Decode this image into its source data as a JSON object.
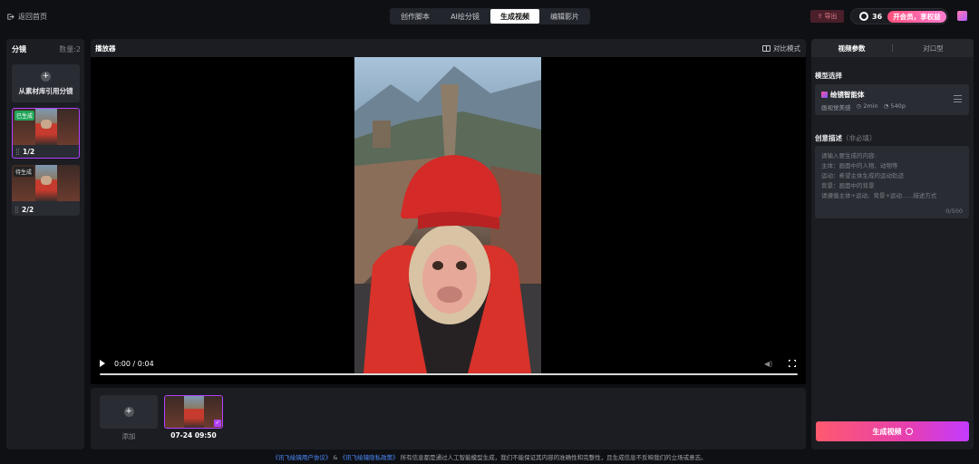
{
  "header": {
    "back_label": "返回首页",
    "tabs": [
      {
        "label": "创作脚本",
        "active": false
      },
      {
        "label": "AI绘分镜",
        "active": false
      },
      {
        "label": "生成视频",
        "active": true
      },
      {
        "label": "编辑影片",
        "active": false
      }
    ],
    "export_label": "导出",
    "credits": "36",
    "vip_label": "开会员，享权益"
  },
  "shots_panel": {
    "title": "分镜",
    "count": "数量:2",
    "add_label": "从素材库引用分镜",
    "shots": [
      {
        "status": "已生成",
        "index": "1/2",
        "selected": true
      },
      {
        "status": "待生成",
        "index": "2/2",
        "selected": false
      }
    ]
  },
  "player": {
    "title": "播放器",
    "compare_label": "对比模式",
    "time": "0:00 / 0:04"
  },
  "strip": {
    "add_label": "添加",
    "clips": [
      {
        "label": "07-24 09:50"
      }
    ]
  },
  "params": {
    "tabs": [
      {
        "label": "视频参数",
        "active": true
      },
      {
        "label": "对口型",
        "active": false
      }
    ],
    "model_label": "模型选择",
    "model_name": "绘镜智能体",
    "model_meta": [
      "画视觉美感",
      "2min",
      "540p"
    ],
    "desc_label": "创意描述",
    "desc_optional": "（非必填）",
    "desc_placeholder_lines": [
      "请输入要生成的内容:",
      "主体：画面中的人物、动物等",
      "运动：希望主体生成的运动轨迹",
      "背景：画面中的背景",
      "请遵循主体+运动、背景+运动......描述方式"
    ],
    "desc_count": "0/500",
    "generate_label": "生成视频"
  },
  "footer": {
    "link1": "《讯飞绘镜用户协议》",
    "amp": "&",
    "link2": "《讯飞绘镜隐私政策》",
    "notice": "所有信息都是通过人工智能模型生成，我们不能保证其内容的准确性和完整性，且生成信息不反映我们的立场或意志。"
  },
  "colors": {
    "accent": "#b042ff",
    "vip_gradient_start": "#ff4f7b",
    "generate_gradient_end": "#c33bff",
    "done_badge": "#23a55a"
  }
}
